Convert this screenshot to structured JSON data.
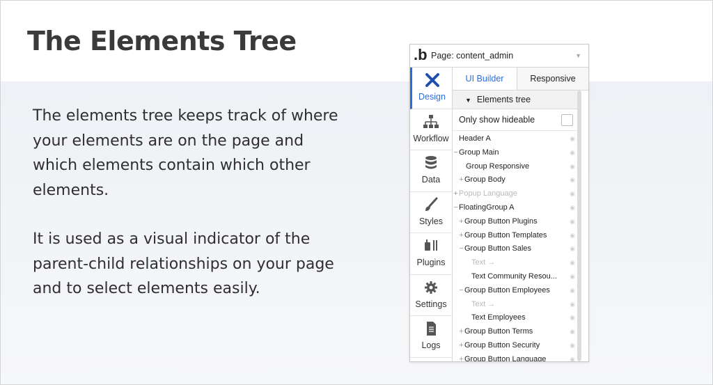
{
  "slide": {
    "title": "The Elements Tree",
    "paragraph1": "The elements tree keeps track of where your elements are on the page and which elements contain which other elements.",
    "paragraph2": "It is used as a visual indicator of the parent-child relationships on your page and to select elements easily."
  },
  "editor": {
    "logo": ".b",
    "page_selector": "Page: content_admin",
    "sidebar": [
      {
        "label": "Design",
        "icon": "design-icon",
        "active": true
      },
      {
        "label": "Workflow",
        "icon": "workflow-icon"
      },
      {
        "label": "Data",
        "icon": "database-icon"
      },
      {
        "label": "Styles",
        "icon": "brush-icon"
      },
      {
        "label": "Plugins",
        "icon": "plugin-icon"
      },
      {
        "label": "Settings",
        "icon": "gear-icon"
      },
      {
        "label": "Logs",
        "icon": "document-icon"
      }
    ],
    "tabs": [
      "UI Builder",
      "Responsive"
    ],
    "tree_header": "Elements tree",
    "only_show_hideable": "Only show hideable",
    "tree": [
      {
        "prefix": "",
        "label": "Header A",
        "muted": false
      },
      {
        "prefix": "−",
        "label": "Group Main",
        "muted": false
      },
      {
        "prefix": "",
        "label": "Group Responsive",
        "muted": false,
        "indent": 1
      },
      {
        "prefix": "+",
        "label": "Group Body",
        "muted": false,
        "indent": 0
      },
      {
        "prefix": "+",
        "label": "Popup Language",
        "muted": true
      },
      {
        "prefix": "−",
        "label": "FloatingGroup A",
        "muted": false
      },
      {
        "prefix": "+",
        "label": "Group Button Plugins",
        "muted": false,
        "indent": 0
      },
      {
        "prefix": "+",
        "label": "Group Button Templates",
        "muted": false,
        "indent": 0
      },
      {
        "prefix": "−",
        "label": "Group Button Sales",
        "muted": false,
        "indent": 0
      },
      {
        "prefix": "",
        "label": "Text →",
        "muted": true,
        "indent": 2
      },
      {
        "prefix": "",
        "label": "Text Community Resou...",
        "muted": false,
        "indent": 2
      },
      {
        "prefix": "−",
        "label": "Group Button Employees",
        "muted": false,
        "indent": 0
      },
      {
        "prefix": "",
        "label": "Text →",
        "muted": true,
        "indent": 2
      },
      {
        "prefix": "",
        "label": "Text Employees",
        "muted": false,
        "indent": 2
      },
      {
        "prefix": "+",
        "label": "Group Button Terms",
        "muted": false,
        "indent": 0
      },
      {
        "prefix": "+",
        "label": "Group Button Security",
        "muted": false,
        "indent": 0
      },
      {
        "prefix": "+",
        "label": "Group Button Language",
        "muted": false,
        "indent": 0
      }
    ],
    "accent_color": "#2b6dd8"
  }
}
